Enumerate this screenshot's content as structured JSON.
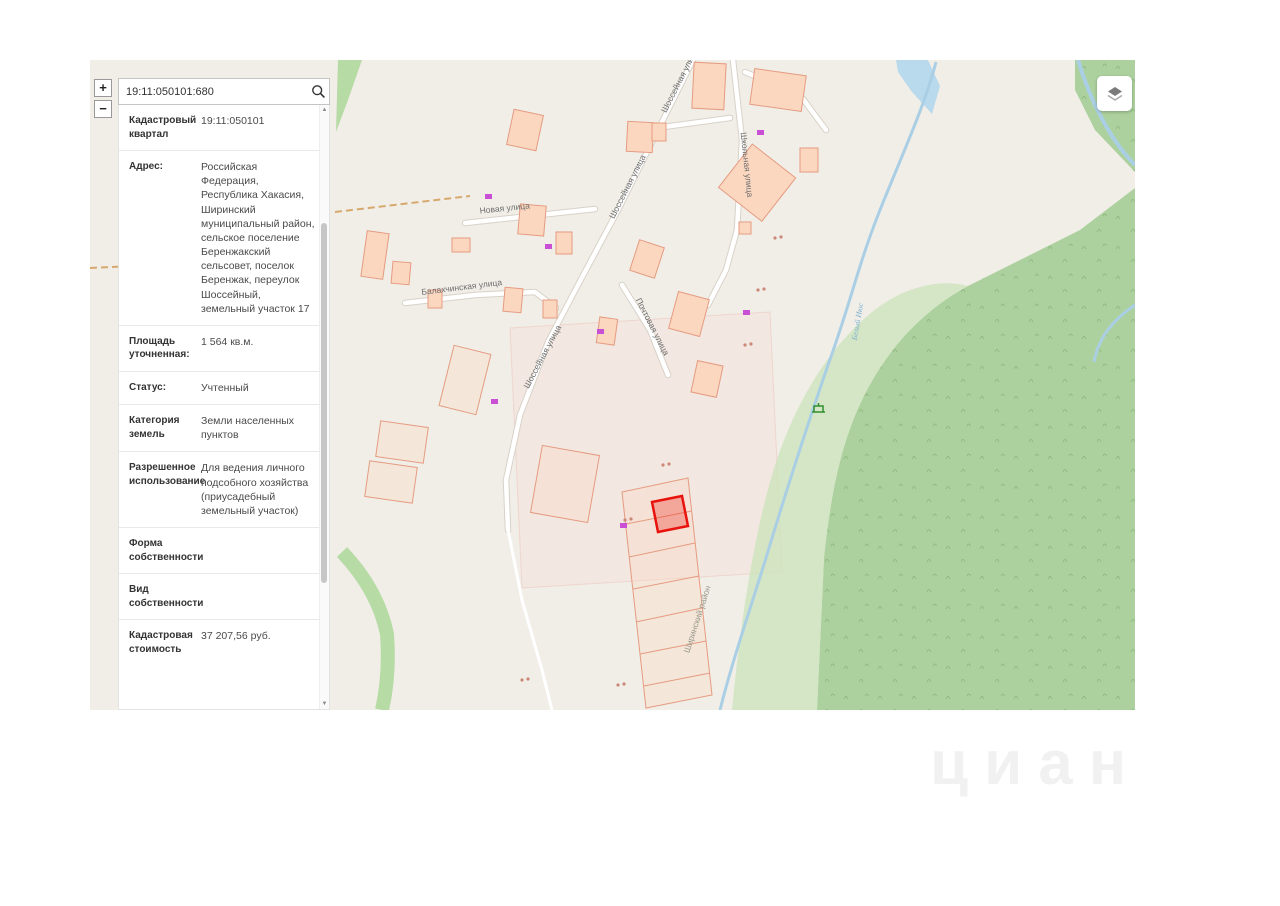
{
  "search": {
    "value": "19:11:050101:680"
  },
  "zoom": {
    "in": "+",
    "out": "−"
  },
  "panel": {
    "rows": [
      {
        "label": "Кадастровый квартал",
        "value": "19:11:050101"
      },
      {
        "label": "Адрес:",
        "value": "Российская Федерация, Республика Хакасия, Ширинский муниципальный район, сельское поселение Беренжакский сельсовет, поселок Беренжак, переулок Шоссейный, земельный участок 17"
      },
      {
        "label": "Площадь уточненная:",
        "value": "1 564 кв.м."
      },
      {
        "label": "Статус:",
        "value": "Учтенный"
      },
      {
        "label": "Категория земель",
        "value": "Земли населенных пунктов"
      },
      {
        "label": "Разрешенное использование",
        "value": "Для ведения личного подсобного хозяйства (приусадебный земельный участок)"
      },
      {
        "label": "Форма собственности",
        "value": ""
      },
      {
        "label": "Вид собственности",
        "value": ""
      },
      {
        "label": "Кадастровая стоимость",
        "value": "37 207,56 руб."
      }
    ]
  },
  "map": {
    "labels": [
      {
        "text": "Новая улица"
      },
      {
        "text": "Балахчинская улица"
      },
      {
        "text": "Шоссейная улица"
      },
      {
        "text": "Шоссейная улица"
      },
      {
        "text": "Шоссейная улица"
      },
      {
        "text": "Почтовая улица"
      },
      {
        "text": "Школьная улица"
      },
      {
        "text": "Ширинский район"
      },
      {
        "text": "Белый Июс"
      }
    ],
    "colors": {
      "base": "#f1eee8",
      "forest": "#add19e",
      "forest_light": "#cde4bb",
      "water": "#aacfe4",
      "building_fill": "#fbd7c0",
      "building_stroke": "#e59b80",
      "selected_parcel": "#e8130c",
      "marker": "#c94fd4",
      "road": "#ffffff"
    }
  },
  "watermark": {
    "text": "циан"
  }
}
